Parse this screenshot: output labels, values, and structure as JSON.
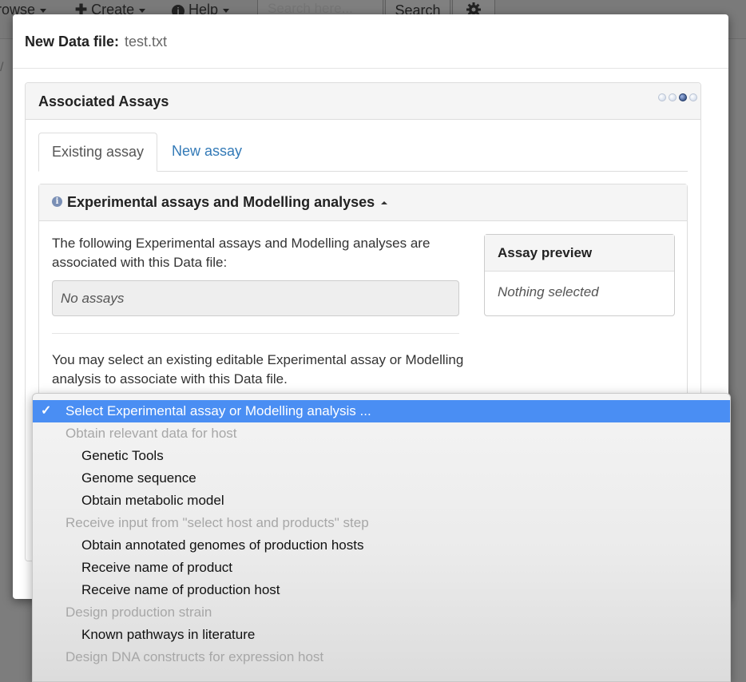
{
  "navbar": {
    "browse_label": "rowse",
    "create_label": "Create",
    "help_label": "Help",
    "search_placeholder": "Search here...",
    "search_button": "Search",
    "breadcrumb_fragment": "/"
  },
  "modal": {
    "title_label": "New Data file:",
    "title_value": "test.txt"
  },
  "associated_panel": {
    "heading": "Associated Assays",
    "tabs": [
      "Existing assay",
      "New assay"
    ],
    "sub_heading": "Experimental assays and Modelling analyses",
    "associated_text": "The following Experimental assays and Modelling analyses are associated with this Data file:",
    "no_assays": "No assays",
    "select_text": "You may select an existing editable Experimental assay or Modelling analysis to associate with this Data file.",
    "preview_heading": "Assay preview",
    "preview_body": "Nothing selected"
  },
  "dropdown": {
    "options": [
      {
        "type": "selected",
        "label": "Select Experimental assay or Modelling analysis ..."
      },
      {
        "type": "group",
        "label": "Obtain relevant data for host"
      },
      {
        "type": "item",
        "label": "Genetic Tools"
      },
      {
        "type": "item",
        "label": "Genome sequence"
      },
      {
        "type": "item",
        "label": "Obtain metabolic model"
      },
      {
        "type": "group",
        "label": "Receive input from \"select host and products\" step"
      },
      {
        "type": "item",
        "label": "Obtain annotated genomes of production hosts"
      },
      {
        "type": "item",
        "label": "Receive name of product"
      },
      {
        "type": "item",
        "label": "Receive name of production host"
      },
      {
        "type": "group",
        "label": "Design production strain"
      },
      {
        "type": "item",
        "label": "Known pathways in literature"
      },
      {
        "type": "group",
        "label": "Design DNA constructs for expression host"
      }
    ]
  },
  "icons": {
    "create": "plus-icon",
    "help": "info-circle-icon",
    "settings": "gear-icon",
    "info": "info-icon",
    "collapse": "caret-up-icon",
    "check": "checkmark-icon"
  }
}
